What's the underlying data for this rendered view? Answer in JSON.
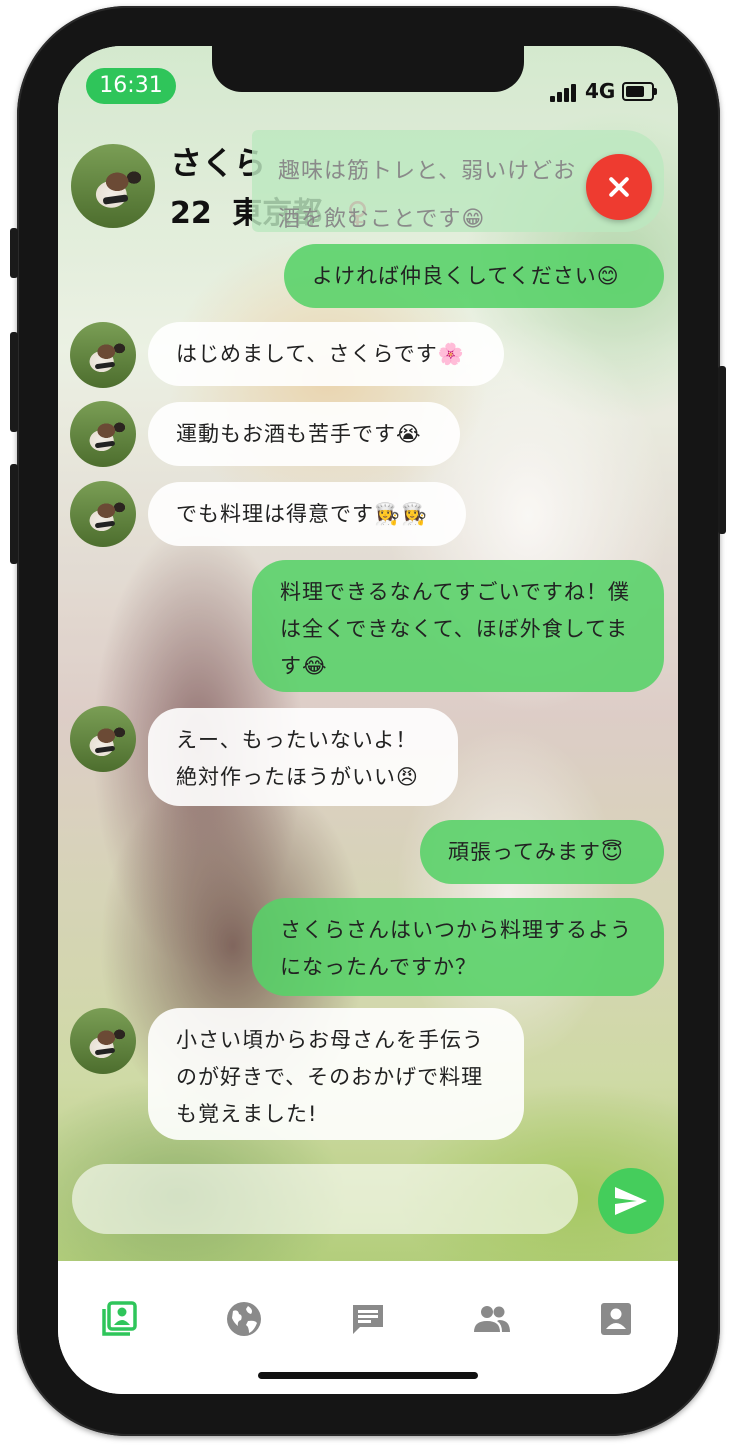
{
  "status_bar": {
    "time": "16:31",
    "network": "4G"
  },
  "profile": {
    "name": "さくら",
    "age": "22",
    "location": "東京都",
    "gender_symbol": "♀"
  },
  "notification": {
    "text": "趣味は筋トレと、弱いけどお酒を飲むことです😁"
  },
  "messages": [
    {
      "side": "out",
      "text": "よければ仲良くしてください😊"
    },
    {
      "side": "in",
      "text": "はじめまして、さくらです🌸"
    },
    {
      "side": "in",
      "text": "運動もお酒も苦手です😭"
    },
    {
      "side": "in",
      "text": "でも料理は得意です👩‍🍳👩‍🍳"
    },
    {
      "side": "out",
      "text": "料理できるなんてすごいですね！僕は全くできなくて、ほぼ外食してます😂"
    },
    {
      "side": "in",
      "text": "えー、もったいないよ！絶対作ったほうがいい😠"
    },
    {
      "side": "out",
      "text": "頑張ってみます😇"
    },
    {
      "side": "out",
      "text": "さくらさんはいつから料理するようになったんですか？"
    },
    {
      "side": "in",
      "text": "小さい頃からお母さんを手伝うのが好きで、そのおかげで料理も覚えました!"
    }
  ],
  "composer": {
    "value": ""
  },
  "tabs": [
    {
      "icon": "profile-card-icon",
      "active": true
    },
    {
      "icon": "globe-icon",
      "active": false
    },
    {
      "icon": "chat-icon",
      "active": false
    },
    {
      "icon": "people-icon",
      "active": false
    },
    {
      "icon": "account-icon",
      "active": false
    }
  ],
  "colors": {
    "accent": "#2fc55a",
    "close": "#ee3b30",
    "outgoing_bubble": "#57d268",
    "tab_inactive": "#8a8a8a"
  }
}
